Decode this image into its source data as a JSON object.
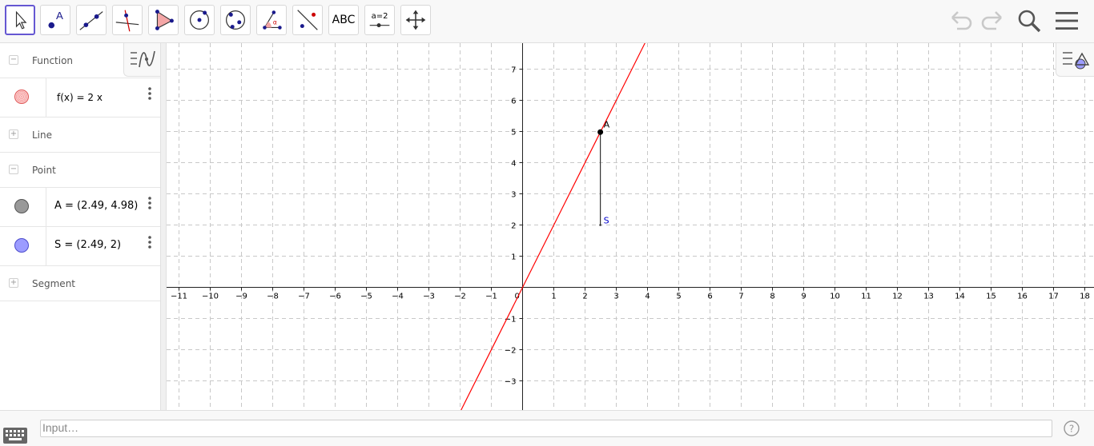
{
  "toolbar": {
    "tools": [
      {
        "name": "move-tool",
        "selected": true
      },
      {
        "name": "point-tool",
        "label": "A"
      },
      {
        "name": "line-tool"
      },
      {
        "name": "perpendicular-line-tool"
      },
      {
        "name": "polygon-tool"
      },
      {
        "name": "circle-center-point-tool"
      },
      {
        "name": "conic-through-points-tool"
      },
      {
        "name": "angle-tool",
        "label": "α"
      },
      {
        "name": "reflect-tool"
      },
      {
        "name": "text-tool",
        "label": "ABC"
      },
      {
        "name": "slider-tool",
        "label": "a=2"
      },
      {
        "name": "move-graphics-view-tool"
      }
    ],
    "right_icons": [
      "undo-icon",
      "redo-icon",
      "search-icon",
      "menu-icon"
    ]
  },
  "algebra": {
    "groups": {
      "function": {
        "label": "Function",
        "expanded": true
      },
      "line": {
        "label": "Line",
        "expanded": false
      },
      "point": {
        "label": "Point",
        "expanded": true
      },
      "segment": {
        "label": "Segment",
        "expanded": false
      }
    },
    "items": {
      "f": {
        "expression": "f(x) = 2 x",
        "color": "#f44336"
      },
      "A": {
        "expression": "A = (2.49, 4.98)",
        "color": "#8c8c8c"
      },
      "S": {
        "expression": "S = (2.49, 2)",
        "color": "#9c9cff"
      }
    }
  },
  "graphics": {
    "x_ticks": [
      "−11",
      "−10",
      "−9",
      "−8",
      "−7",
      "−6",
      "−5",
      "−4",
      "−3",
      "−2",
      "−1",
      "1",
      "2",
      "3",
      "4",
      "5",
      "6",
      "7",
      "8",
      "9",
      "10",
      "11",
      "12",
      "13",
      "14",
      "15",
      "16",
      "17",
      "18"
    ],
    "y_ticks": [
      "7",
      "6",
      "5",
      "4",
      "3",
      "2",
      "1",
      "−1",
      "−2",
      "−3"
    ],
    "origin_label": "0",
    "xlim": [
      -11.4,
      18.3
    ],
    "ylim": [
      -3.9,
      7.9
    ],
    "function": {
      "name": "f",
      "slope": 2,
      "color": "#ff0000"
    },
    "points": {
      "A": {
        "label": "A",
        "x": 2.49,
        "y": 4.98,
        "color": "#000000"
      },
      "S": {
        "label": "S",
        "x": 2.49,
        "y": 2,
        "color": "#0000cc"
      }
    },
    "segment": {
      "from": "A",
      "to": "S"
    }
  },
  "input": {
    "placeholder": "Input…"
  }
}
